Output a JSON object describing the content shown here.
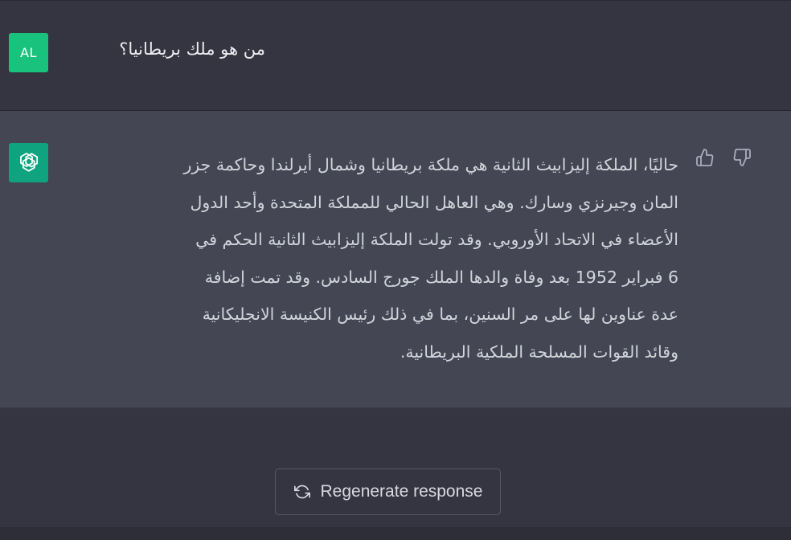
{
  "user_message": {
    "avatar_initials": "AL",
    "text": "من هو ملك بريطانيا؟"
  },
  "assistant_message": {
    "avatar_icon": "openai-logo-icon",
    "lines": [
      "حاليًا، الملكة إليزابيث الثانية هي ملكة بريطانيا وشمال أيرلندا وحاكمة جزر",
      "المان وجيرنزي وسارك. وهي العاهل الحالي للمملكة المتحدة وأحد الدول",
      "الأعضاء في الاتحاد الأوروبي. وقد تولت الملكة إليزابيث الثانية الحكم في",
      "6 فبراير 1952 بعد وفاة والدها الملك جورج السادس. وقد تمت إضافة",
      "عدة عناوين لها على مر السنين، بما في ذلك رئيس الكنيسة الانجليكانية",
      "وقائد القوات المسلحة الملكية البريطانية."
    ],
    "feedback_icons": [
      "thumbs-up-icon",
      "thumbs-down-icon"
    ]
  },
  "regenerate_button": {
    "icon": "refresh-icon",
    "label": "Regenerate response"
  },
  "colors": {
    "page_bg": "#343541",
    "assistant_bg": "#444654",
    "user_avatar": "#19c37d",
    "bot_avatar": "#10a37f",
    "text": "#d1d5db"
  }
}
